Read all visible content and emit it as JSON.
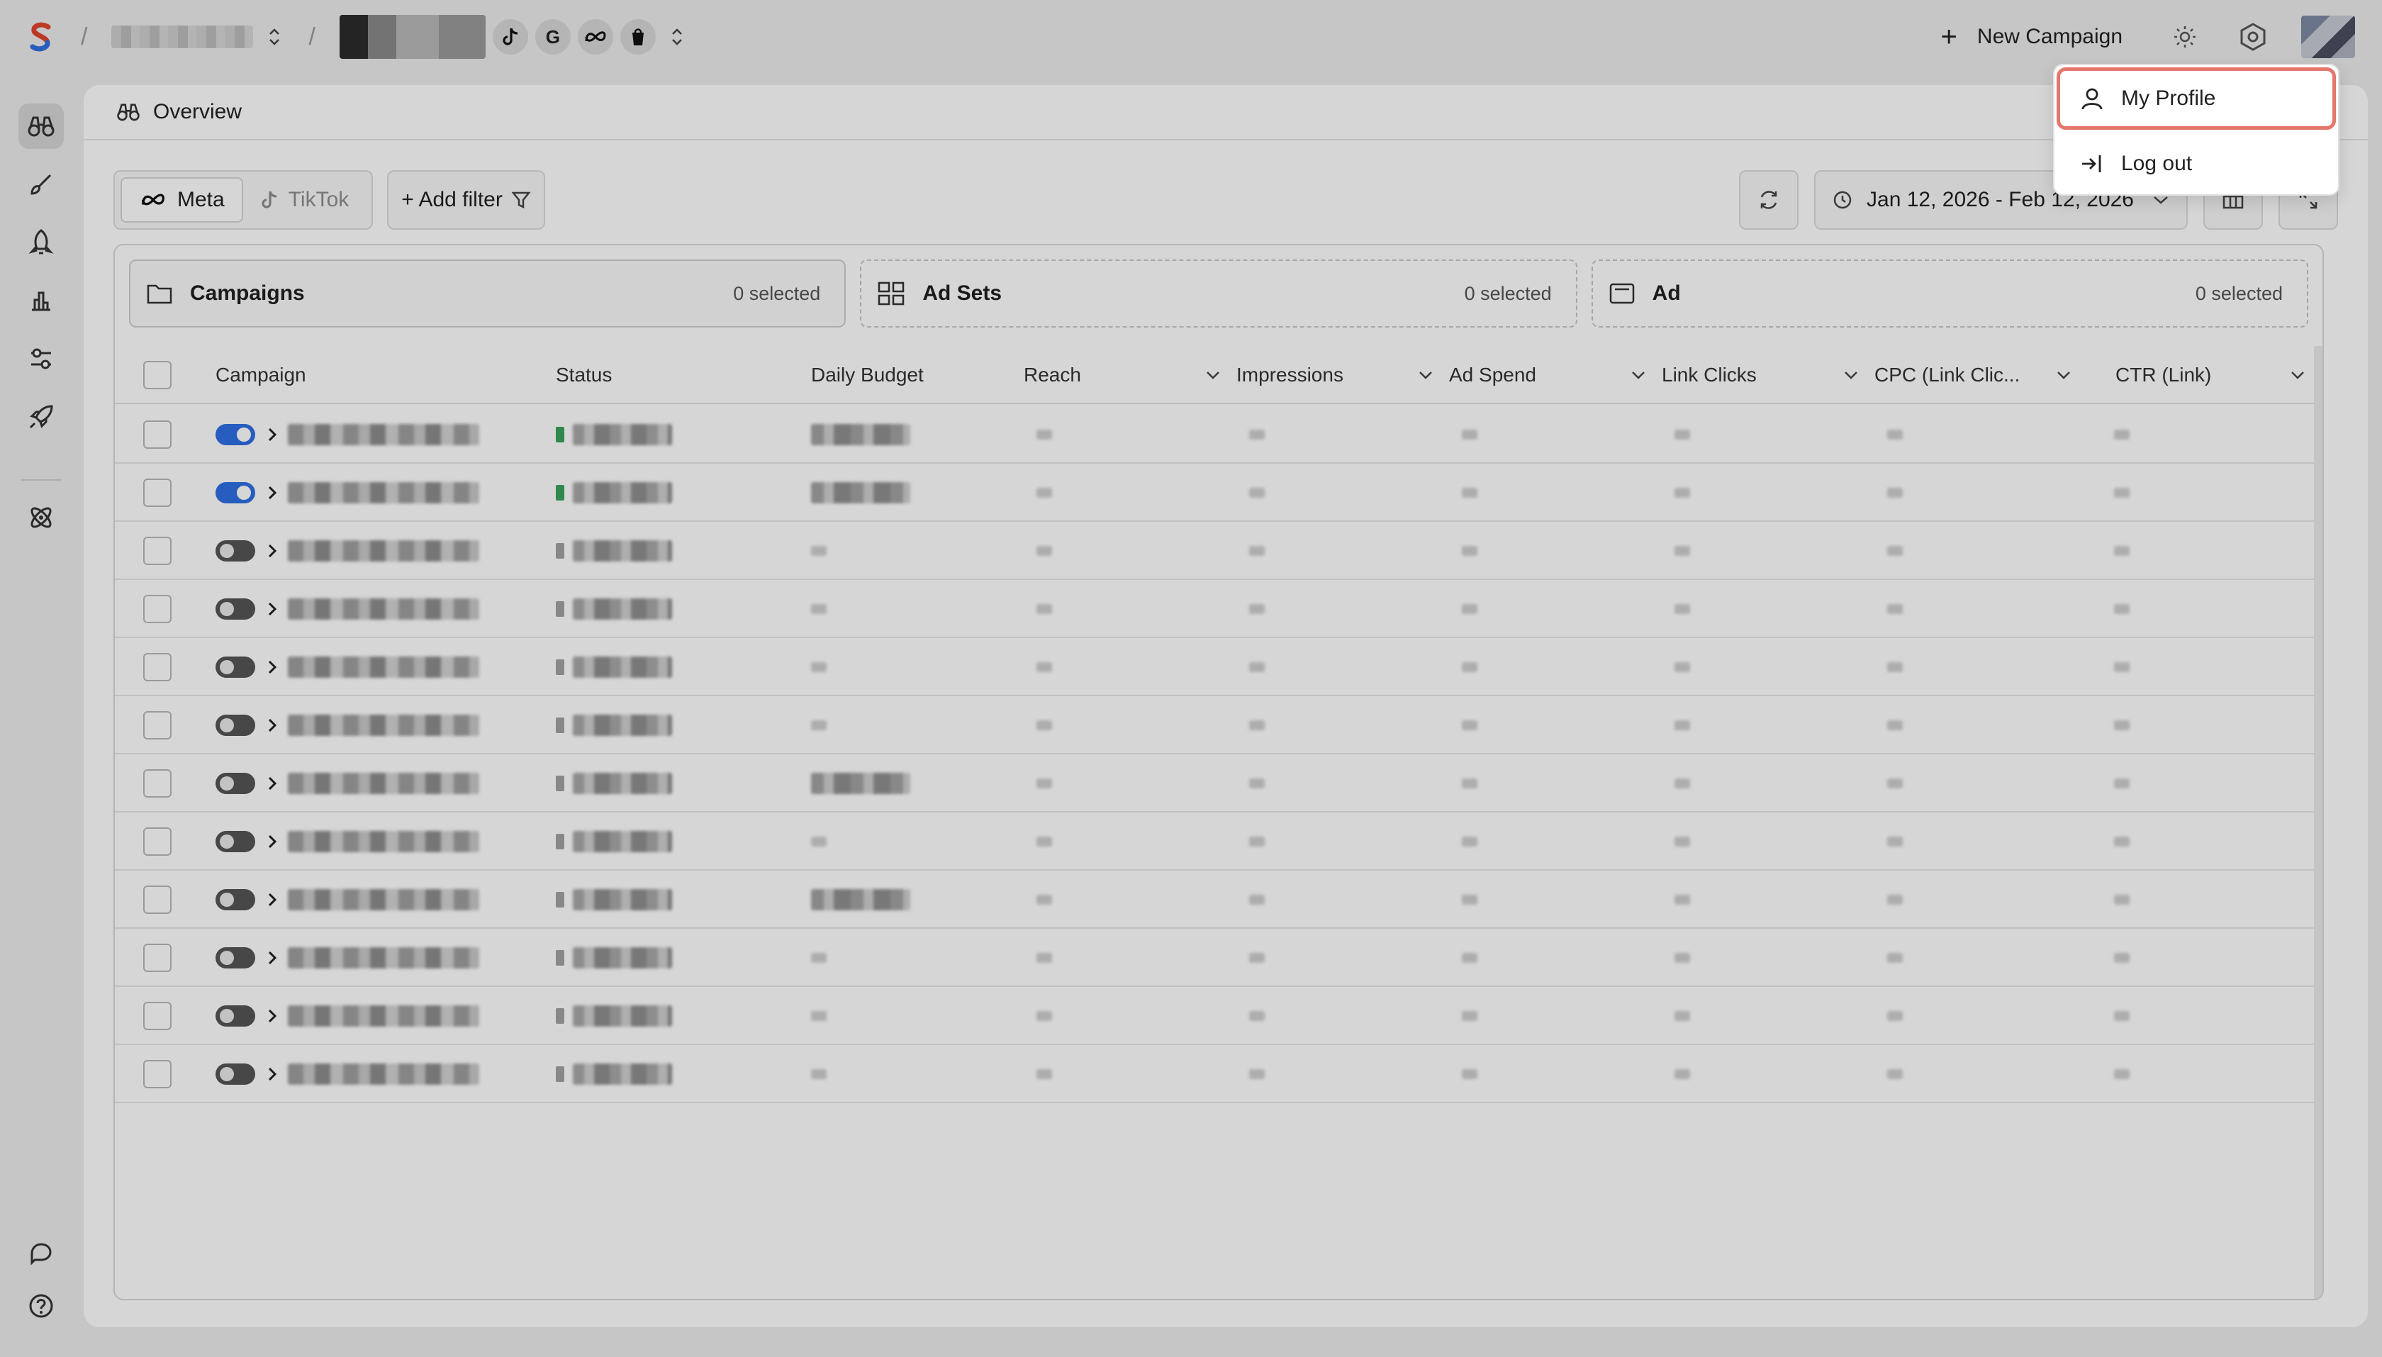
{
  "topbar": {
    "new_campaign_label": "New Campaign",
    "channel_letters": [
      "G"
    ]
  },
  "main": {
    "page_title": "Overview",
    "platforms": [
      {
        "label": "Meta",
        "active": true
      },
      {
        "label": "TikTok",
        "active": false
      }
    ],
    "add_filter_label": "+ Add filter",
    "date_range": "Jan 12, 2026 - Feb 12, 2026"
  },
  "levels": [
    {
      "label": "Campaigns",
      "selected": "0 selected"
    },
    {
      "label": "Ad Sets",
      "selected": "0 selected"
    },
    {
      "label": "Ad",
      "selected": "0 selected"
    }
  ],
  "table": {
    "columns": [
      "Campaign",
      "Status",
      "Daily Budget",
      "Reach",
      "Impressions",
      "Ad Spend",
      "Link Clicks",
      "CPC (Link Clic...",
      "CTR (Link)"
    ],
    "row_toggles": [
      true,
      true,
      false,
      false,
      false,
      false,
      false,
      false,
      false,
      false,
      false,
      false
    ]
  },
  "dropdown": {
    "items": [
      "My Profile",
      "Log out"
    ]
  },
  "colors": {
    "accent": "#2f6fe4",
    "highlight": "#e5766c",
    "status_active": "#3aa35c"
  }
}
